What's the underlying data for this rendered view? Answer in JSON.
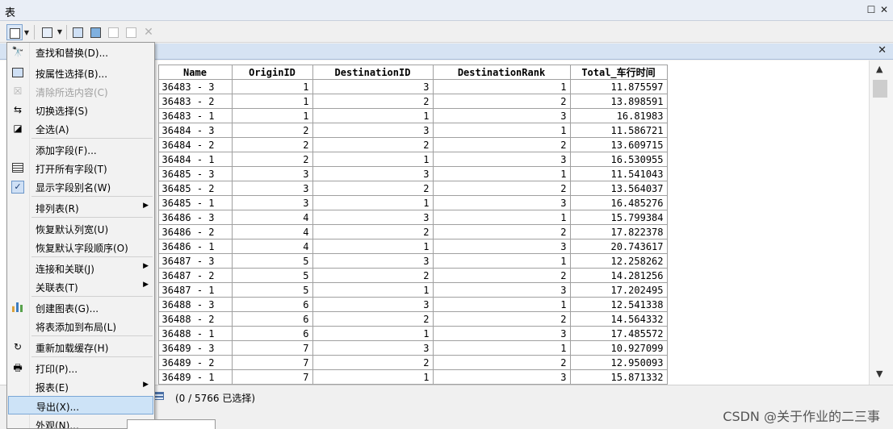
{
  "window": {
    "title": "表",
    "restore_glyph": "☐",
    "close_glyph": "✕"
  },
  "tabstrip": {
    "close_glyph": "✕"
  },
  "table": {
    "columns": [
      "Name",
      "OriginID",
      "DestinationID",
      "DestinationRank",
      "Total_车行时间"
    ],
    "rows": [
      [
        "36483 - 3",
        "1",
        "3",
        "1",
        "11.875597"
      ],
      [
        "36483 - 2",
        "1",
        "2",
        "2",
        "13.898591"
      ],
      [
        "36483 - 1",
        "1",
        "1",
        "3",
        "16.81983"
      ],
      [
        "36484 - 3",
        "2",
        "3",
        "1",
        "11.586721"
      ],
      [
        "36484 - 2",
        "2",
        "2",
        "2",
        "13.609715"
      ],
      [
        "36484 - 1",
        "2",
        "1",
        "3",
        "16.530955"
      ],
      [
        "36485 - 3",
        "3",
        "3",
        "1",
        "11.541043"
      ],
      [
        "36485 - 2",
        "3",
        "2",
        "2",
        "13.564037"
      ],
      [
        "36485 - 1",
        "3",
        "1",
        "3",
        "16.485276"
      ],
      [
        "36486 - 3",
        "4",
        "3",
        "1",
        "15.799384"
      ],
      [
        "36486 - 2",
        "4",
        "2",
        "2",
        "17.822378"
      ],
      [
        "36486 - 1",
        "4",
        "1",
        "3",
        "20.743617"
      ],
      [
        "36487 - 3",
        "5",
        "3",
        "1",
        "12.258262"
      ],
      [
        "36487 - 2",
        "5",
        "2",
        "2",
        "14.281256"
      ],
      [
        "36487 - 1",
        "5",
        "1",
        "3",
        "17.202495"
      ],
      [
        "36488 - 3",
        "6",
        "3",
        "1",
        "12.541338"
      ],
      [
        "36488 - 2",
        "6",
        "2",
        "2",
        "14.564332"
      ],
      [
        "36488 - 1",
        "6",
        "1",
        "3",
        "17.485572"
      ],
      [
        "36489 - 3",
        "7",
        "3",
        "1",
        "10.927099"
      ],
      [
        "36489 - 2",
        "7",
        "2",
        "2",
        "12.950093"
      ],
      [
        "36489 - 1",
        "7",
        "1",
        "3",
        "15.871332"
      ]
    ]
  },
  "status": {
    "selection_text": "(0 / 5766 已选择)"
  },
  "menu": {
    "items": [
      {
        "label": "查找和替换(D)...",
        "icon": "binoculars-icon",
        "glyph": "🔭"
      },
      {
        "label": "按属性选择(B)...",
        "icon": "select-by-attributes-icon",
        "glyph": ""
      },
      {
        "label": "清除所选内容(C)",
        "icon": "clear-selection-icon",
        "glyph": "☒",
        "disabled": true
      },
      {
        "label": "切换选择(S)",
        "icon": "switch-selection-icon",
        "glyph": "⇆"
      },
      {
        "label": "全选(A)",
        "icon": "select-all-icon",
        "glyph": "◪"
      },
      {
        "label": "添加字段(F)...",
        "icon": "",
        "glyph": ""
      },
      {
        "label": "打开所有字段(T)",
        "icon": "table-icon",
        "glyph": ""
      },
      {
        "label": "显示字段别名(W)",
        "icon": "checkmark-icon",
        "glyph": "✓"
      },
      {
        "label": "排列表(R)",
        "icon": "",
        "glyph": "",
        "submenu": true
      },
      {
        "label": "恢复默认列宽(U)",
        "icon": "",
        "glyph": ""
      },
      {
        "label": "恢复默认字段顺序(O)",
        "icon": "",
        "glyph": ""
      },
      {
        "label": "连接和关联(J)",
        "icon": "",
        "glyph": "",
        "submenu": true
      },
      {
        "label": "关联表(T)",
        "icon": "",
        "glyph": "",
        "submenu": true
      },
      {
        "label": "创建图表(G)...",
        "icon": "bar-chart-icon",
        "glyph": ""
      },
      {
        "label": "将表添加到布局(L)",
        "icon": "",
        "glyph": ""
      },
      {
        "label": "重新加载缓存(H)",
        "icon": "refresh-icon",
        "glyph": "↻"
      },
      {
        "label": "打印(P)...",
        "icon": "printer-icon",
        "glyph": "🖶"
      },
      {
        "label": "报表(E)",
        "icon": "",
        "glyph": "",
        "submenu": true
      },
      {
        "label": "导出(X)...",
        "icon": "",
        "glyph": "",
        "highlighted": true
      },
      {
        "label": "外观(N)...",
        "icon": "",
        "glyph": ""
      }
    ]
  },
  "watermark": "CSDN @关于作业的二三事"
}
